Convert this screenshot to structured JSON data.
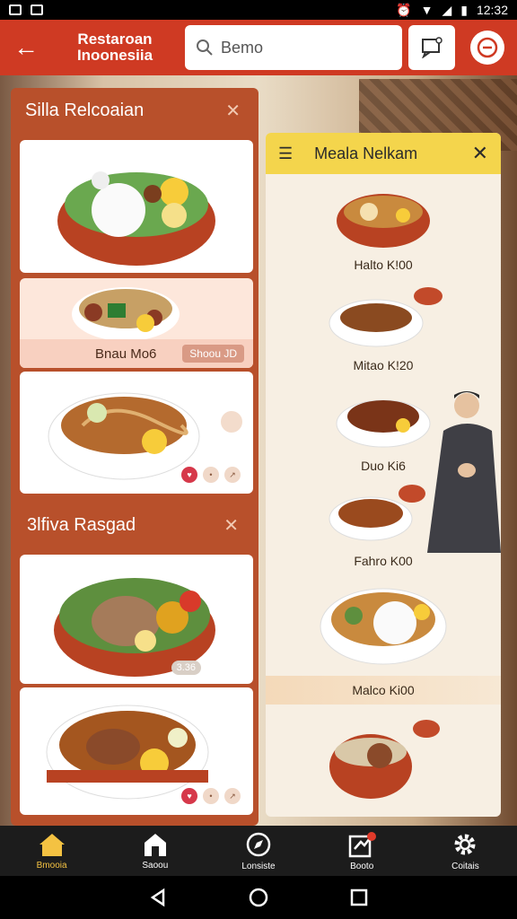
{
  "status": {
    "time": "12:32"
  },
  "header": {
    "brand_line1": "Restaroan",
    "brand_line2": "Inoonesiia",
    "search_value": "Bemo"
  },
  "left_panel": {
    "section1_title": "Silla Relcoaian",
    "section2_title": "3lfiva Rasgad",
    "card2_name": "Bnau Mo6",
    "card2_tag": "Shoou JD",
    "card4_badge": "3.36"
  },
  "right_panel": {
    "title": "Meala Nelkam",
    "items": [
      {
        "label": "Halto K!00"
      },
      {
        "label": "Mitao K!20"
      },
      {
        "label": "Duo Ki6"
      },
      {
        "label": "Fahro K00"
      },
      {
        "label": "Malco Ki00"
      }
    ]
  },
  "bottom_nav": {
    "items": [
      {
        "label": "Bmooia"
      },
      {
        "label": "Saoou"
      },
      {
        "label": "Lonsiste"
      },
      {
        "label": "Booto"
      },
      {
        "label": "Coitais"
      }
    ]
  },
  "colors": {
    "topbar": "#cf3a23",
    "left_panel": "#b8502b",
    "right_header": "#f4d54c",
    "nav_active": "#f4c242"
  }
}
